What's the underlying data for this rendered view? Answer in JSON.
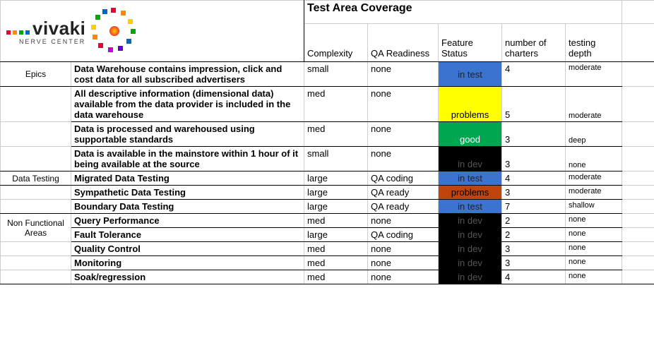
{
  "title": "Test Area Coverage",
  "logo": {
    "name": "vivaki",
    "subtitle": "NERVE CENTER"
  },
  "columns": {
    "complexity": "Complexity",
    "qa_readiness": "QA Readiness",
    "feature_status": "Feature Status",
    "charters": "number of charters",
    "depth": "testing depth"
  },
  "sections": [
    {
      "label": "Epics"
    },
    {
      "label": "Data Testing"
    },
    {
      "label": "Non Functional Areas"
    }
  ],
  "rows": [
    {
      "desc": "Data Warehouse contains impression, click and cost data for all subscribed advertisers",
      "complexity": "small",
      "qa": "none",
      "status": "in test",
      "status_class": "status-intest",
      "charters": "4",
      "depth": "moderate"
    },
    {
      "desc": "All descriptive information (dimensional data) available from the data provider is included in the data warehouse",
      "complexity": "med",
      "qa": "none",
      "status": "problems",
      "status_class": "status-problems-y",
      "charters": "5",
      "depth": "moderate"
    },
    {
      "desc": "Data is processed and warehoused using supportable standards",
      "complexity": "med",
      "qa": "none",
      "status": "good",
      "status_class": "status-good",
      "charters": "3",
      "depth": "deep"
    },
    {
      "desc": "Data is available in the mainstore within 1 hour of it being available at the source",
      "complexity": "small",
      "qa": "none",
      "status": "in dev",
      "status_class": "status-indev",
      "charters": "3",
      "depth": "none"
    },
    {
      "desc": "Migrated Data Testing",
      "complexity": "large",
      "qa": "QA coding",
      "status": "in test",
      "status_class": "status-intest",
      "charters": "4",
      "depth": "moderate"
    },
    {
      "desc": "Sympathetic Data Testing",
      "complexity": "large",
      "qa": "QA ready",
      "status": "problems",
      "status_class": "status-problems-r",
      "charters": "3",
      "depth": "moderate"
    },
    {
      "desc": "Boundary Data Testing",
      "complexity": "large",
      "qa": "QA ready",
      "status": "in test",
      "status_class": "status-intest",
      "charters": "7",
      "depth": "shallow"
    },
    {
      "desc": "Query Performance",
      "complexity": "med",
      "qa": "none",
      "status": "in dev",
      "status_class": "status-indev",
      "charters": "2",
      "depth": "none"
    },
    {
      "desc": "Fault Tolerance",
      "complexity": "large",
      "qa": "QA coding",
      "status": "in dev",
      "status_class": "status-indev",
      "charters": "2",
      "depth": "none"
    },
    {
      "desc": "Quality Control",
      "complexity": "med",
      "qa": "none",
      "status": "in dev",
      "status_class": "status-indev",
      "charters": "3",
      "depth": "none"
    },
    {
      "desc": "Monitoring",
      "complexity": "med",
      "qa": "none",
      "status": "in dev",
      "status_class": "status-indev",
      "charters": "3",
      "depth": "none"
    },
    {
      "desc": "Soak/regression",
      "complexity": "med",
      "qa": "none",
      "status": "in dev",
      "status_class": "status-indev",
      "charters": "4",
      "depth": "none"
    }
  ]
}
